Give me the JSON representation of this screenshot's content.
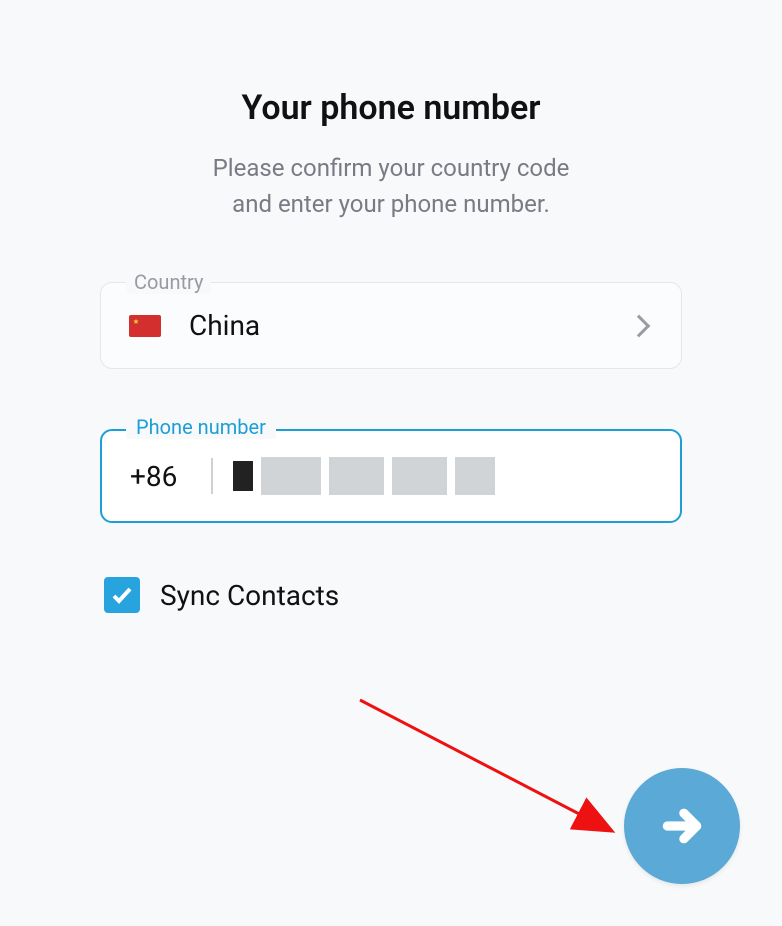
{
  "header": {
    "title": "Your phone number",
    "subtitle": "Please confirm your country code\nand enter your phone number."
  },
  "country": {
    "label": "Country",
    "flag": "china-flag",
    "name": "China"
  },
  "phone": {
    "label": "Phone number",
    "code": "+86",
    "value_redacted": true
  },
  "sync": {
    "checked": true,
    "label": "Sync Contacts"
  },
  "fab": {
    "icon": "arrow-right-icon"
  },
  "colors": {
    "accent": "#1c9fd6",
    "fab": "#5aa9d6",
    "checkbox": "#27a3de"
  }
}
